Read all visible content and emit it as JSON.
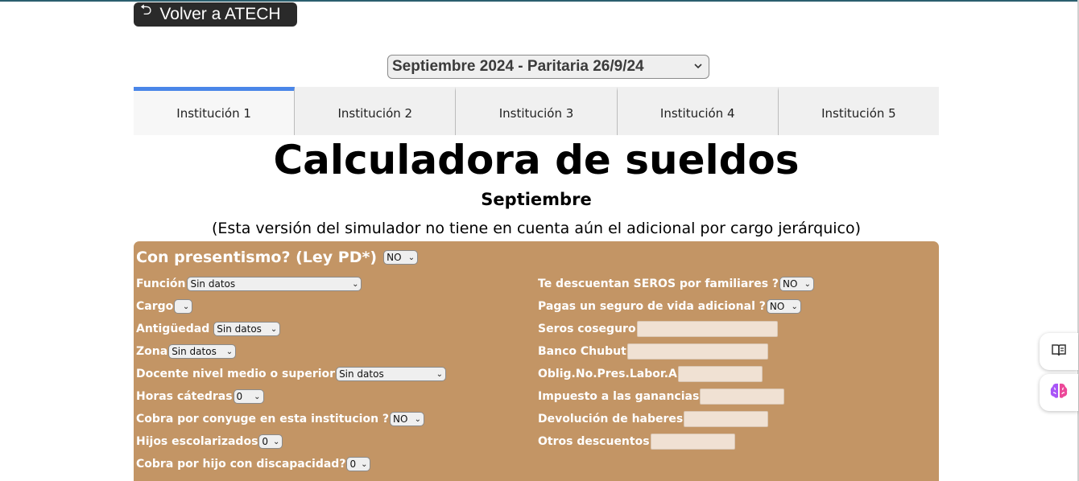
{
  "header": {
    "back_label": "Volver a ATECH"
  },
  "period": {
    "selected": "Septiembre 2024 - Paritaria 26/9/24"
  },
  "tabs": [
    "Institución 1",
    "Institución 2",
    "Institución 3",
    "Institución 4",
    "Institución 5"
  ],
  "active_tab": 0,
  "page": {
    "title": "Calculadora de sueldos",
    "subtitle": "Septiembre",
    "note": "(Esta versión del simulador no tiene en cuenta aún el adicional por cargo jerárquico)"
  },
  "form": {
    "presentismo": {
      "label": "Con presentismo? (Ley PD*)",
      "value": "NO"
    },
    "left": [
      {
        "label": "Función",
        "value": "Sin datos"
      },
      {
        "label": "Cargo",
        "value": ""
      },
      {
        "label": "Antigüedad",
        "value": "Sin datos"
      },
      {
        "label": "Zona",
        "value": "Sin datos"
      },
      {
        "label": "Docente nivel medio o superior",
        "value": "Sin datos"
      },
      {
        "label": "Horas cátedras",
        "value": "0"
      },
      {
        "label": "Cobra por conyuge en esta institucion ?",
        "value": "NO"
      },
      {
        "label": "Hijos escolarizados",
        "value": "0"
      },
      {
        "label": "Cobra por hijo con discapacidad?",
        "value": "0"
      }
    ],
    "right": [
      {
        "label": "Te descuentan SEROS por familiares ?",
        "value": "NO"
      },
      {
        "label": "Pagas un seguro de vida adicional ?",
        "value": "NO"
      },
      {
        "label": "Seros coseguro",
        "value": ""
      },
      {
        "label": "Banco Chubut",
        "value": ""
      },
      {
        "label": "Oblig.No.Pres.Labor.A",
        "value": ""
      },
      {
        "label": "Impuesto a las ganancias",
        "value": ""
      },
      {
        "label": "Devolución de haberes",
        "value": ""
      },
      {
        "label": "Otros descuentos",
        "value": ""
      }
    ]
  },
  "colors": {
    "panel": "#c39565",
    "tab_active": "#4a86e8",
    "back_button": "#2a2a2a",
    "input_bg": "#f0e1d3"
  },
  "icons": [
    "undo-arrow-icon",
    "chevron-down-icon",
    "book-icon",
    "brain-icon"
  ]
}
